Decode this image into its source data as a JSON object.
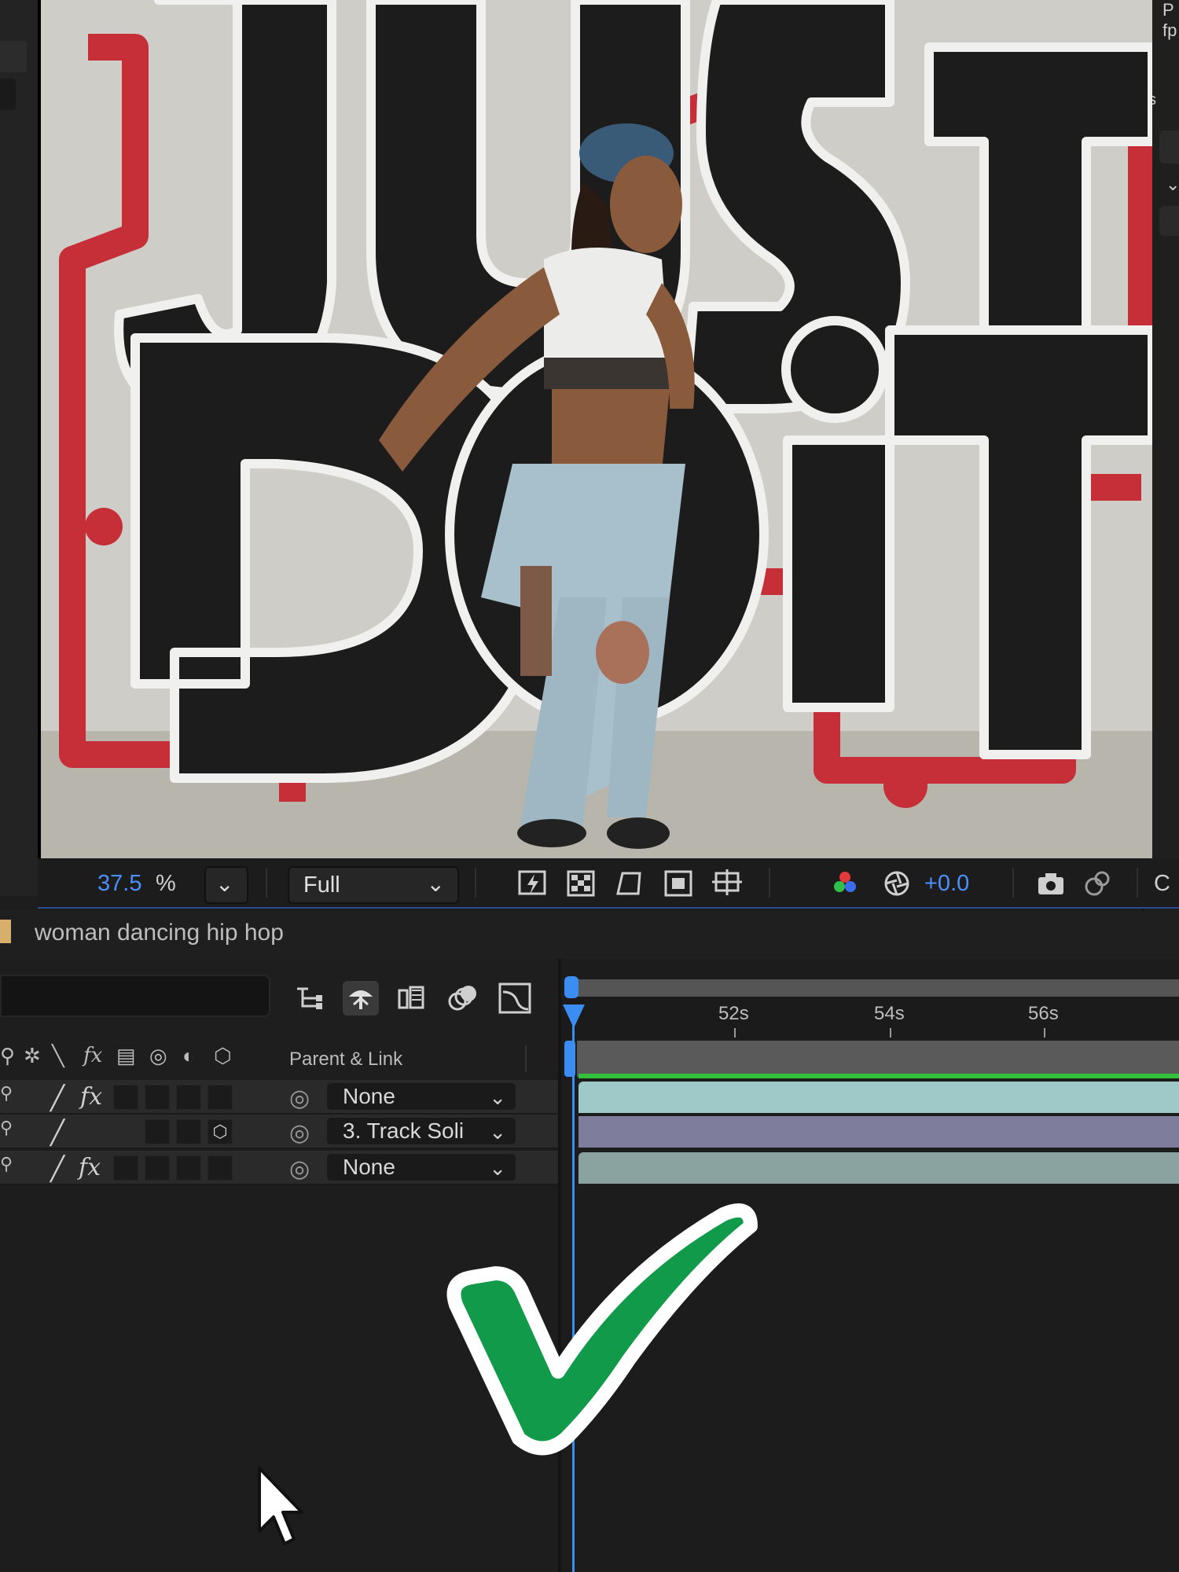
{
  "viewer": {
    "footage_description_text": "",
    "toolbar": {
      "zoom_value": "37.5",
      "zoom_unit": "%",
      "resolution": "Full",
      "exposure": "+0.0",
      "trailing_text": "C"
    },
    "icons": [
      "snapshot-toggle-icon",
      "transparency-grid-icon",
      "mask-path-icon",
      "region-of-interest-icon",
      "guides-icon",
      "color-channels-icon",
      "exposure-reset-icon",
      "camera-snapshot-icon",
      "show-snapshot-icon"
    ]
  },
  "right_panel": {
    "line1": "P",
    "line2": "fp",
    "line3": "s"
  },
  "composition": {
    "name": "woman dancing hip hop",
    "swatch_color": "#d7ae6c"
  },
  "switch_header": {
    "parent_link_label": "Parent & Link"
  },
  "layers": [
    {
      "parent": "None",
      "has_fx": true,
      "has_3d": false
    },
    {
      "parent": "3. Track Soli",
      "has_fx": false,
      "has_3d": true
    },
    {
      "parent": "None",
      "has_fx": true,
      "has_3d": false
    }
  ],
  "timeline": {
    "ticks": [
      "52s",
      "54s",
      "56s"
    ],
    "playhead_color": "#3c8df2",
    "track_colors": [
      "#9fc8c8",
      "#7f7d9c",
      "#8aa3a0"
    ],
    "highlight_color": "#33c13c"
  },
  "overlay": {
    "checkmark_color": "#119a4a"
  }
}
